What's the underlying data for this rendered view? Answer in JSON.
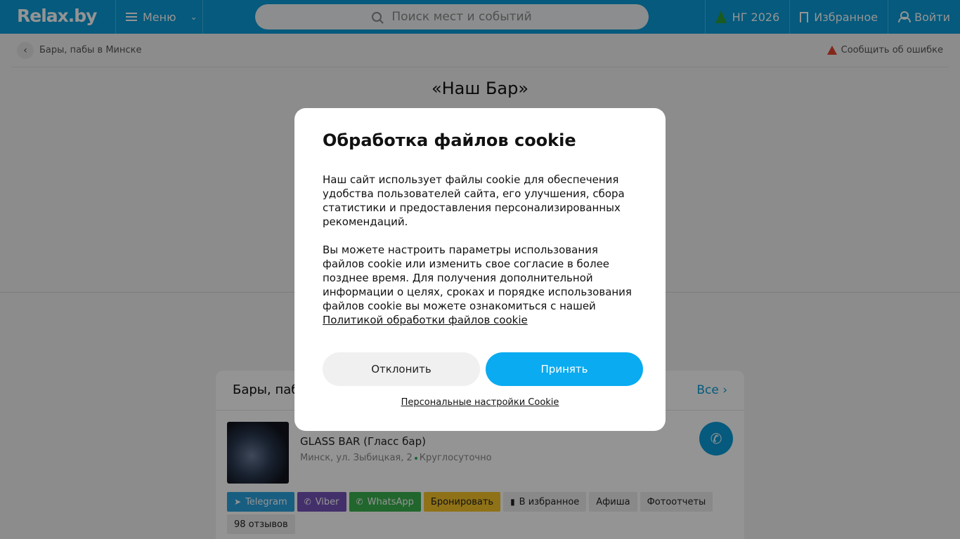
{
  "header": {
    "logo": "Relax.by",
    "menu_label": "Меню",
    "search_placeholder": "Поиск мест и событий",
    "ny_label": "НГ 2026",
    "favorites_label": "Избранное",
    "login_label": "Войти"
  },
  "breadcrumb": {
    "back_label": "Бары, пабы в Минске",
    "report_label": "Сообщить об ошибке"
  },
  "venue": {
    "title": "«Наш Бар»"
  },
  "card": {
    "title": "Бары, паб",
    "all_label": "Все",
    "place": {
      "name": "GLASS BAR (Гласс бар)",
      "address": "Минск, ул. Зыбицкая, 2",
      "hours": "Круглосуточно"
    },
    "actions": [
      "Telegram",
      "Viber",
      "WhatsApp",
      "Бронировать",
      "В избранное",
      "Афиша",
      "Фотоотчеты",
      "98 отзывов"
    ]
  },
  "cookie_modal": {
    "title": "Обработка файлов cookie",
    "paragraph1": "Наш сайт использует файлы cookie для обеспечения удобства пользователей сайта, его улучшения, сбора статистики и предоставления персонализированных рекомендаций.",
    "paragraph2": "Вы можете настроить параметры использования файлов cookie или изменить свое согласие в более позднее время. Для получения дополнительной информации о целях, сроках и порядке использования файлов cookie вы можете ознакомиться с нашей",
    "policy_link": "Политикой обработки файлов cookie",
    "decline_label": "Отклонить",
    "accept_label": "Принять",
    "personal_settings_label": "Персональные настройки Cookie"
  },
  "colors": {
    "brand": "#0a9bd8",
    "accept": "#0aabf0"
  }
}
